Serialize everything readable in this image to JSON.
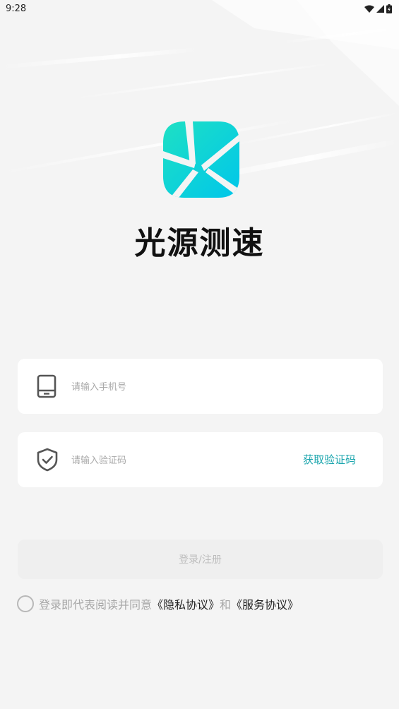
{
  "status_bar": {
    "time": "9:28"
  },
  "app": {
    "title": "光源测速"
  },
  "phone_field": {
    "placeholder": "请输入手机号",
    "value": ""
  },
  "code_field": {
    "placeholder": "请输入验证码",
    "value": "",
    "get_code_label": "获取验证码"
  },
  "login_button": {
    "label": "登录/注册"
  },
  "agreement": {
    "prefix": "登录即代表阅读并同意",
    "privacy_link": "《隐私协议》",
    "connector": "和",
    "service_link": "《服务协议》"
  },
  "colors": {
    "brand_gradient_start": "#1ee0c4",
    "brand_gradient_end": "#00c9e8",
    "link_accent": "#1aa5ad"
  },
  "icons": [
    "wifi-icon",
    "signal-icon",
    "battery-icon",
    "app-logo-icon",
    "phone-icon",
    "shield-check-icon"
  ]
}
